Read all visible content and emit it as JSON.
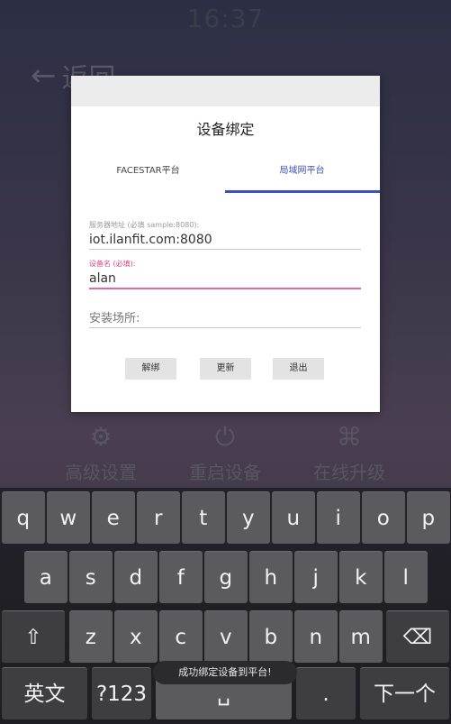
{
  "status": {
    "time": "16:37"
  },
  "back": {
    "label": "返回"
  },
  "background": {
    "items": [
      {
        "label": "高级设置",
        "icon": "gear-icon"
      },
      {
        "label": "重启设备",
        "icon": "power-icon"
      },
      {
        "label": "在线升级",
        "icon": "grid-icon"
      }
    ]
  },
  "dialog": {
    "title": "设备绑定",
    "tabs": [
      "FACESTAR平台",
      "局域网平台"
    ],
    "server_label": "服务器地址 (必填 sample:8080):",
    "server_value": "iot.ilanfit.com:8080",
    "device_label": "设备名 (必填):",
    "device_value": "alan",
    "location_placeholder": "安装场所:",
    "buttons": {
      "unbind": "解绑",
      "update": "更新",
      "exit": "退出"
    }
  },
  "keyboard": {
    "row1": [
      "q",
      "w",
      "e",
      "r",
      "t",
      "y",
      "u",
      "i",
      "o",
      "p"
    ],
    "row2": [
      "a",
      "s",
      "d",
      "f",
      "g",
      "h",
      "j",
      "k",
      "l"
    ],
    "row3": [
      "z",
      "x",
      "c",
      "v",
      "b",
      "n",
      "m"
    ],
    "shift": "⇧",
    "backspace": "⌫",
    "lang": "英文",
    "num": "?123",
    "space": "␣",
    "period": ".",
    "next": "下一个"
  },
  "toast": "成功绑定设备到平台!"
}
